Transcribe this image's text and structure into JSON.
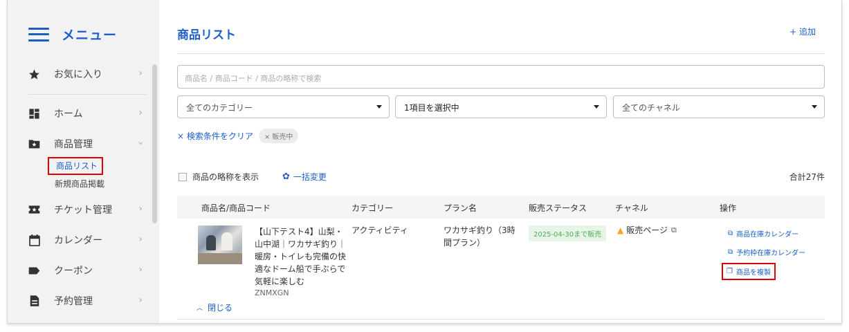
{
  "sidebar": {
    "title": "メニュー",
    "items": [
      {
        "label": "お気に入り",
        "icon": "star-icon"
      },
      {
        "label": "ホーム",
        "icon": "dashboard-icon"
      },
      {
        "label": "商品管理",
        "icon": "folder-star-icon"
      },
      {
        "label": "チケット管理",
        "icon": "ticket-icon"
      },
      {
        "label": "カレンダー",
        "icon": "calendar-icon"
      },
      {
        "label": "クーポン",
        "icon": "tag-icon"
      },
      {
        "label": "予約管理",
        "icon": "document-icon"
      }
    ],
    "sub_items": {
      "active": "商品リスト",
      "new": "新規商品掲載"
    }
  },
  "main": {
    "title": "商品リスト",
    "add_label": "+ 追加",
    "search_placeholder": "商品名 / 商品コード / 商品の略称で検索",
    "filters": {
      "category": "全てのカテゴリー",
      "status": "1項目を選択中",
      "channel": "全てのチャネル"
    },
    "clear_label": "× 検索条件をクリア",
    "chip_label": "× 販売中",
    "show_abbrev_label": "商品の略称を表示",
    "bulk_label": "一括変更",
    "total_label": "合計27件",
    "table": {
      "headers": [
        "商品名/商品コード",
        "カテゴリー",
        "プラン名",
        "販売ステータス",
        "チャネル",
        "操作"
      ],
      "row": {
        "name": "【山下テスト4】山梨・山中湖｜ワカサギ釣り｜暖房・トイレも完備の快適なドーム船で手ぶらで気軽に楽しむ",
        "code": "ZNMXGN",
        "category": "アクティビティ",
        "plan": "ワカサギ釣り（3時間プラン）",
        "status": "2025-04-30まで販売",
        "channel": "販売ページ",
        "ops": [
          "商品在庫カレンダー",
          "予約枠在庫カレンダー",
          "商品を複製"
        ],
        "collapse_label": "閉じる"
      }
    }
  },
  "colors": {
    "accent": "#1a5fc8",
    "highlight": "#e00000",
    "status_green": "#4caf50",
    "warning": "#f5a623"
  }
}
